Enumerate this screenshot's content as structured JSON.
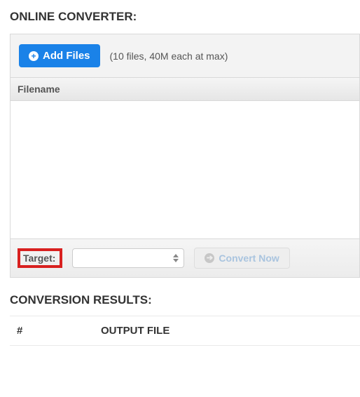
{
  "sections": {
    "converter": {
      "title": "ONLINE CONVERTER:",
      "add_files_label": "Add Files",
      "files_note": "(10 files, 40M each at max)",
      "filename_header": "Filename",
      "target_label": "Target:",
      "target_value": "",
      "convert_label": "Convert Now"
    },
    "results": {
      "title": "CONVERSION RESULTS:",
      "col_num": "#",
      "col_file": "OUTPUT FILE"
    }
  }
}
